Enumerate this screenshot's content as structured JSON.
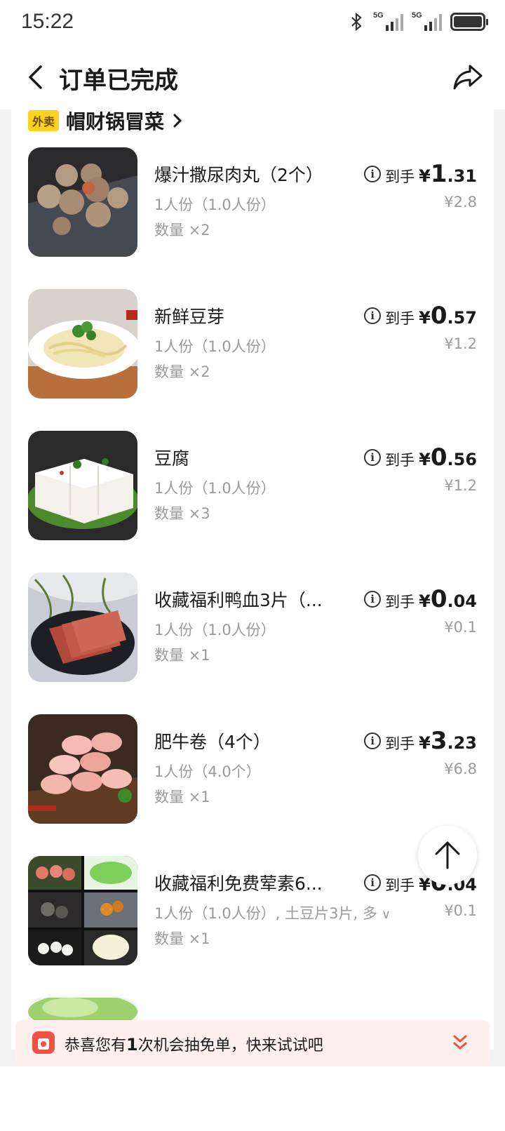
{
  "status": {
    "time": "15:22",
    "signal1_label": "5G",
    "signal2_label": "5G"
  },
  "nav": {
    "title": "订单已完成"
  },
  "shop": {
    "badge": "外卖",
    "name": "帽财锅冒菜"
  },
  "items": [
    {
      "name": "爆汁撒尿肉丸（2个）",
      "spec": "1人份（1.0人份）",
      "qty": "数量 ×2",
      "label": "到手",
      "currency": "¥",
      "price_int": "1",
      "price_dec": ".31",
      "original": "¥2.8"
    },
    {
      "name": "新鲜豆芽",
      "spec": "1人份（1.0人份）",
      "qty": "数量 ×2",
      "label": "到手",
      "currency": "¥",
      "price_int": "0",
      "price_dec": ".57",
      "original": "¥1.2"
    },
    {
      "name": "豆腐",
      "spec": "1人份（1.0人份）",
      "qty": "数量 ×3",
      "label": "到手",
      "currency": "¥",
      "price_int": "0",
      "price_dec": ".56",
      "original": "¥1.2"
    },
    {
      "name": "收藏福利鸭血3片（...",
      "spec": "1人份（1.0人份）",
      "qty": "数量 ×1",
      "label": "到手",
      "currency": "¥",
      "price_int": "0",
      "price_dec": ".04",
      "original": "¥0.1"
    },
    {
      "name": "肥牛卷（4个）",
      "spec": "1人份（4.0个）",
      "qty": "数量 ×1",
      "label": "到手",
      "currency": "¥",
      "price_int": "3",
      "price_dec": ".23",
      "original": "¥6.8"
    },
    {
      "name": "收藏福利免费荤素6...",
      "spec": "1人份（1.0人份）, 土豆片3片, 多",
      "qty": "数量 ×1",
      "label": "到手",
      "currency": "¥",
      "price_int": "0",
      "price_dec": ".04",
      "original": "¥0.1"
    }
  ],
  "promo": {
    "text_before": "恭喜您有",
    "count": "1",
    "text_after": "次机会抽免单，快来试试吧"
  },
  "colors": {
    "accent_red": "#f05346",
    "badge_yellow": "#ffd21f",
    "promo_bg": "#fff0ee"
  }
}
